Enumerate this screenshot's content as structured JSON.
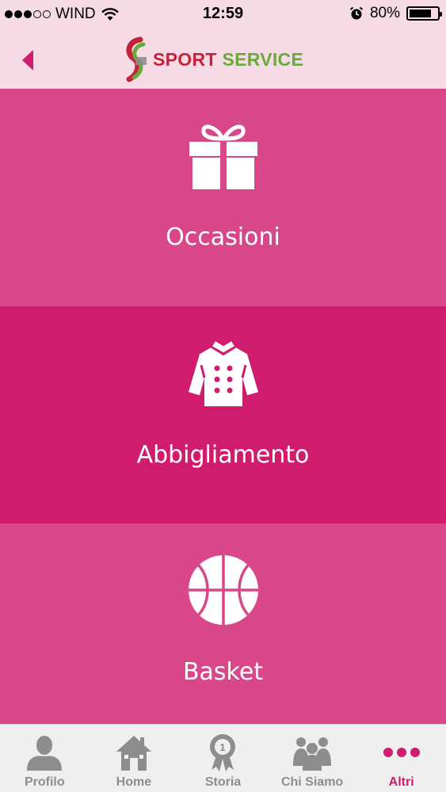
{
  "status_bar": {
    "carrier": "WIND",
    "time": "12:59",
    "battery_percent": "80%",
    "battery_level": 0.8,
    "signal_bars": 3,
    "signal_total": 5
  },
  "nav_bar": {
    "back_icon": "chevron-left-icon",
    "logo": {
      "word1": "SPORT",
      "word2": "SERVICE"
    }
  },
  "menu": [
    {
      "label": "Occasioni",
      "icon": "gift-icon"
    },
    {
      "label": "Abbigliamento",
      "icon": "jacket-icon"
    },
    {
      "label": "Basket",
      "icon": "basketball-icon"
    }
  ],
  "tabs": [
    {
      "label": "Profilo",
      "icon": "person-icon",
      "active": false
    },
    {
      "label": "Home",
      "icon": "house-icon",
      "active": false
    },
    {
      "label": "Storia",
      "icon": "award-icon",
      "active": false
    },
    {
      "label": "Chi Siamo",
      "icon": "people-icon",
      "active": false
    },
    {
      "label": "Altri",
      "icon": "more-icon",
      "active": true
    }
  ],
  "colors": {
    "accent": "#cf1c6e",
    "tile_light": "#d8478a",
    "header_bg": "#f6dbe7",
    "tab_inactive": "#8d8d8d"
  }
}
